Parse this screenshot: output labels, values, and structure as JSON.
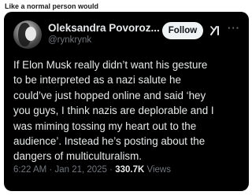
{
  "caption": "Like a normal person would",
  "tweet": {
    "author_name": "Oleksandra Povoroz...",
    "author_handle": "@rynkrynk",
    "follow_label": "Follow",
    "more_label": "···",
    "text_lines": [
      "If Elon Musk really didn’t want his gesture",
      "to be interpreted as a nazi salute he",
      "could’ve just hopped online and said ‘hey",
      "you guys, I think nazis are deplorable and I",
      "was miming tossing my heart out to the",
      "audience’. Instead he’s posting about the",
      "dangers of multiculturalism."
    ],
    "time": "6:22 AM",
    "date": "Jan 21, 2025",
    "views_count": "330.7K",
    "views_label": "Views",
    "separator": "·"
  },
  "colors": {
    "card_bg": "#000000",
    "text_primary": "#e7e9ea",
    "text_secondary": "#71767b",
    "follow_bg": "#eff3f4"
  },
  "icons": {
    "avatar": "avatar-photo",
    "grok": "grok-icon",
    "more": "more-options-icon"
  }
}
